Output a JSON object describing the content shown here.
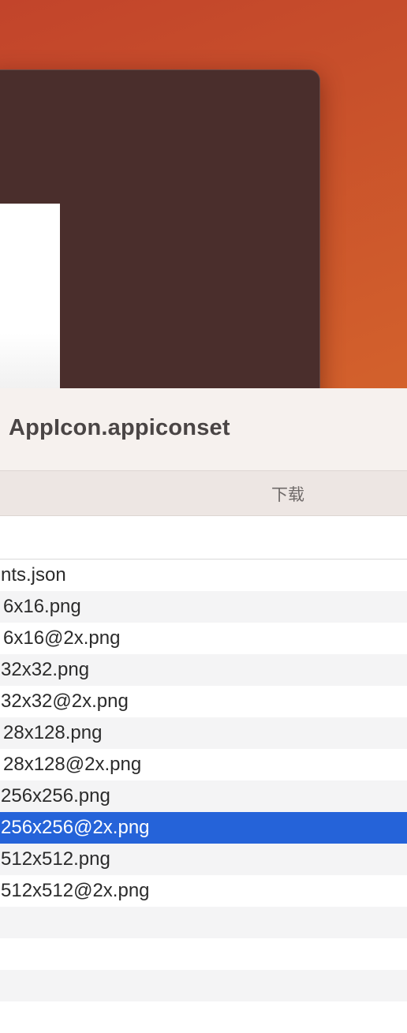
{
  "finder": {
    "title": "AppIcon.appiconset",
    "tab_download": "下载",
    "files": [
      {
        "name": "nts.json",
        "selected": false
      },
      {
        "name": "6x16.png",
        "selected": false
      },
      {
        "name": "6x16@2x.png",
        "selected": false
      },
      {
        "name": "32x32.png",
        "selected": false
      },
      {
        "name": "32x32@2x.png",
        "selected": false
      },
      {
        "name": "28x128.png",
        "selected": false
      },
      {
        "name": "28x128@2x.png",
        "selected": false
      },
      {
        "name": "256x256.png",
        "selected": false
      },
      {
        "name": "256x256@2x.png",
        "selected": true
      },
      {
        "name": "512x512.png",
        "selected": false
      },
      {
        "name": "512x512@2x.png",
        "selected": false
      }
    ]
  },
  "colors": {
    "selection": "#2563d9",
    "desktop_accent": "#c8502b",
    "background_window": "#4a2e2c"
  }
}
